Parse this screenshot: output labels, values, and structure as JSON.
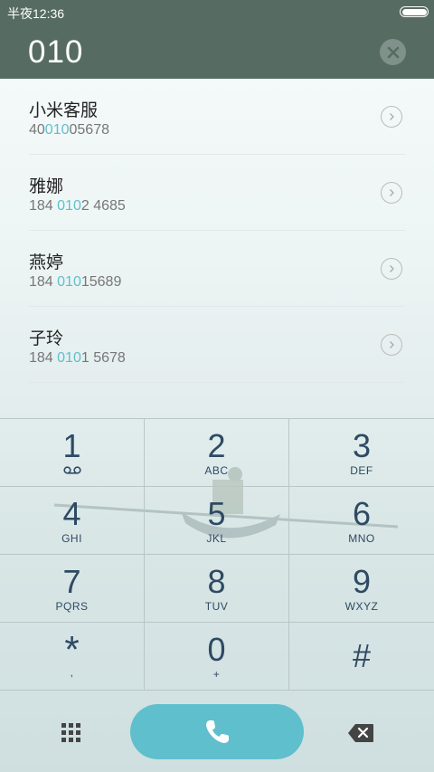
{
  "status_bar": {
    "time": "半夜12:36"
  },
  "dialer": {
    "typed_number": "010"
  },
  "contacts": [
    {
      "name": "小米客服",
      "number_prefix": "40",
      "number_match": "010",
      "number_suffix": "05678"
    },
    {
      "name": "雅娜",
      "number_prefix": "184 ",
      "number_match": "010",
      "number_suffix": "2 4685"
    },
    {
      "name": "燕婷",
      "number_prefix": "184 ",
      "number_match": "010",
      "number_suffix": "15689"
    },
    {
      "name": "子玲",
      "number_prefix": "184 ",
      "number_match": "010",
      "number_suffix": "1 5678"
    }
  ],
  "keypad": [
    {
      "digit": "1",
      "letters": "",
      "sub_icon": "voicemail-icon"
    },
    {
      "digit": "2",
      "letters": "ABC"
    },
    {
      "digit": "3",
      "letters": "DEF"
    },
    {
      "digit": "4",
      "letters": "GHI"
    },
    {
      "digit": "5",
      "letters": "JKL"
    },
    {
      "digit": "6",
      "letters": "MNO"
    },
    {
      "digit": "7",
      "letters": "PQRS"
    },
    {
      "digit": "8",
      "letters": "TUV"
    },
    {
      "digit": "9",
      "letters": "WXYZ"
    },
    {
      "digit": "*",
      "letters": ","
    },
    {
      "digit": "0",
      "letters": "+"
    },
    {
      "digit": "#",
      "letters": ""
    }
  ],
  "colors": {
    "header": "#566c62",
    "accent": "#5fbfcd",
    "key_text": "#2e4a63"
  },
  "icons": [
    "battery-icon",
    "clear-icon",
    "chevron-right-icon",
    "voicemail-icon",
    "keypad-grid-icon",
    "phone-icon",
    "backspace-icon"
  ]
}
